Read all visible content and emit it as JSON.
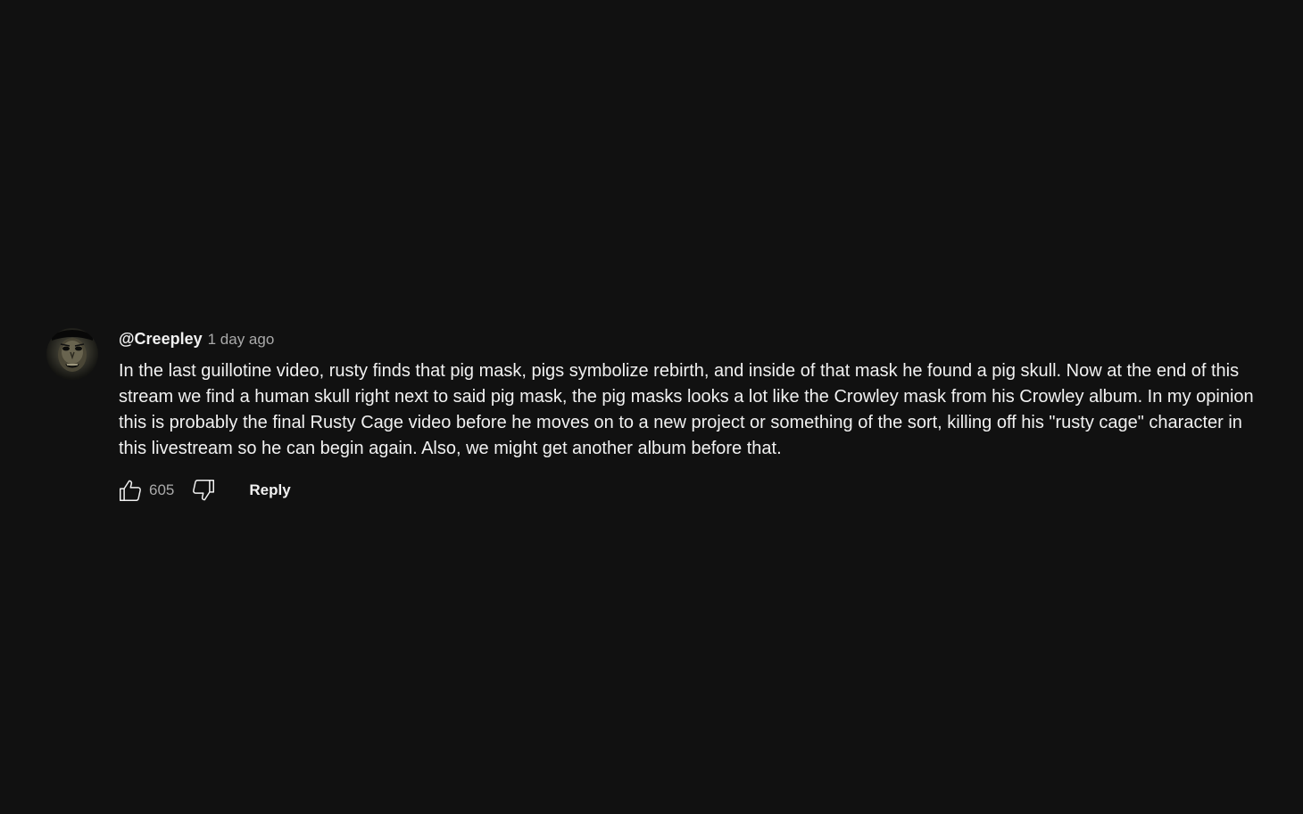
{
  "comment": {
    "author": "@Creepley",
    "timestamp": "1 day ago",
    "text": "In the last guillotine video, rusty finds that pig mask, pigs symbolize rebirth, and inside of that mask he found a pig skull. Now at the end of this stream we find a human skull right next to said pig mask, the pig masks looks a lot like the Crowley mask from his Crowley album. In my opinion this is probably the final Rusty Cage video before he moves on to a new project or something of the sort, killing off his \"rusty cage\" character in this livestream so he can begin again. Also, we might get another album before that.",
    "like_count": "605",
    "reply_label": "Reply",
    "icons": {
      "like": "thumbs-up-icon",
      "dislike": "thumbs-down-icon"
    }
  },
  "colors": {
    "background": "#111111",
    "text_primary": "#f1f1f1",
    "text_secondary": "#aaaaaa"
  }
}
